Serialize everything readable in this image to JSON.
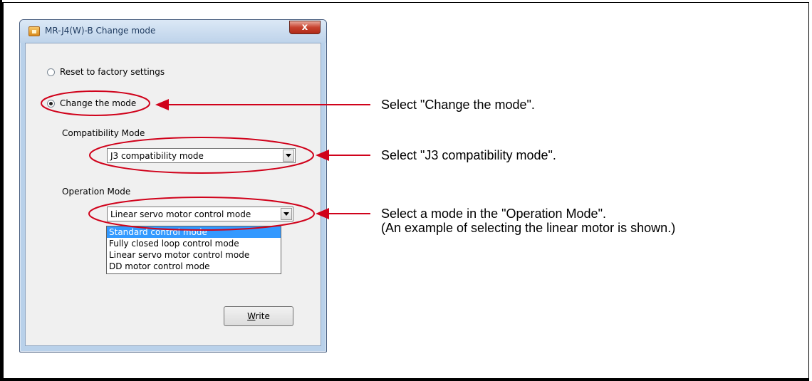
{
  "window": {
    "title": "MR-J4(W)-B Change mode",
    "close_glyph": "x"
  },
  "options": {
    "reset_label": "Reset to factory settings",
    "change_label": "Change the mode",
    "selected": "change"
  },
  "compatibility": {
    "label": "Compatibility Mode",
    "value": "J3 compatibility mode"
  },
  "operation": {
    "label": "Operation Mode",
    "value": "Linear servo motor control mode",
    "options": [
      "Standard control mode",
      "Fully closed loop control mode",
      "Linear servo motor control mode",
      "DD motor control mode"
    ],
    "highlighted_index": 0
  },
  "write_button": {
    "accel": "W",
    "rest": "rite"
  },
  "callouts": {
    "change_mode": "Select \"Change the mode\".",
    "compat": "Select \"J3 compatibility mode\".",
    "operation_line1": "Select a mode in the \"Operation Mode\".",
    "operation_line2": "(An example of selecting the linear motor is shown.)"
  },
  "colors": {
    "annotation": "#d0021b",
    "selection": "#3399ff"
  }
}
